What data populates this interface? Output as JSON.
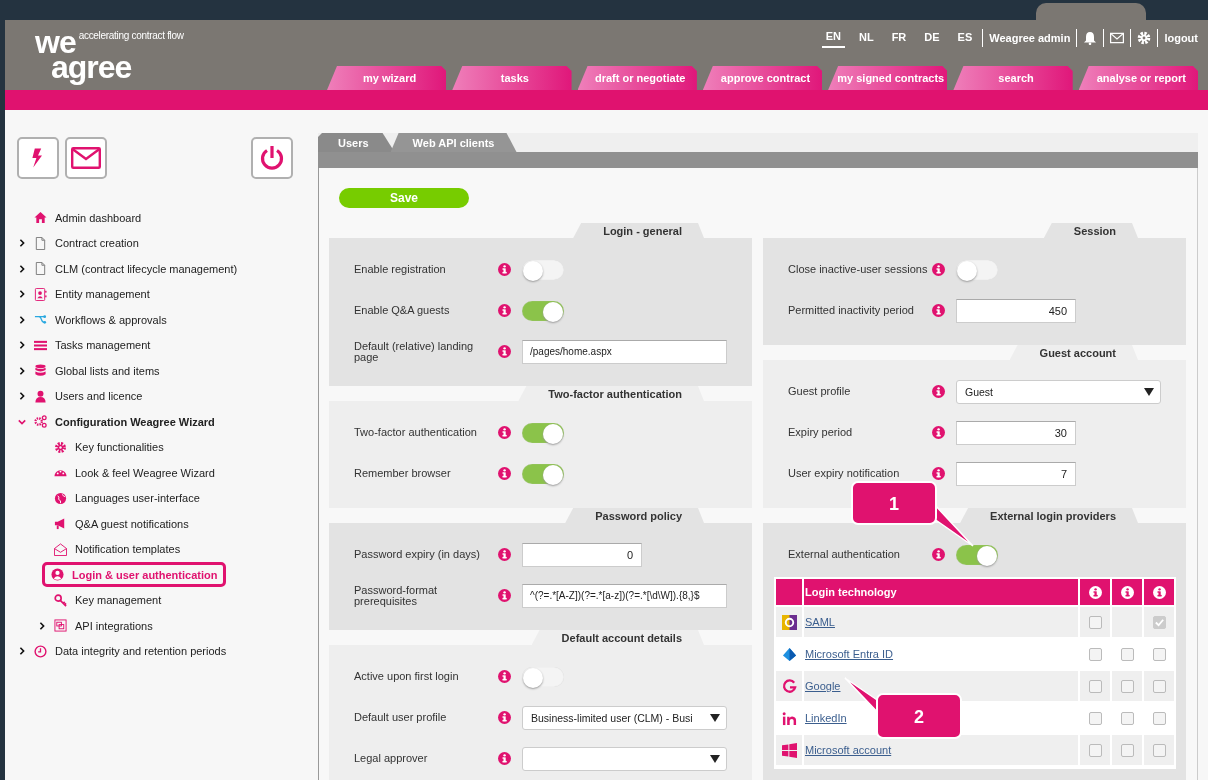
{
  "header": {
    "logo_top": "we",
    "logo_bottom": "agree",
    "tagline": "accelerating contract flow",
    "languages": [
      {
        "label": "EN",
        "selected": true
      },
      {
        "label": "NL",
        "selected": false
      },
      {
        "label": "FR",
        "selected": false
      },
      {
        "label": "DE",
        "selected": false
      },
      {
        "label": "ES",
        "selected": false
      }
    ],
    "user": "Weagree admin",
    "logout": "logout"
  },
  "nav_tabs": [
    "my wizard",
    "tasks",
    "draft or negotiate",
    "approve contract",
    "my signed contracts",
    "search",
    "analyse or report"
  ],
  "sidebar": {
    "items": [
      {
        "label": "Admin dashboard",
        "selected": false
      },
      {
        "label": "Contract creation",
        "expanded": false,
        "selected": false
      },
      {
        "label": "CLM (contract lifecycle management)",
        "expanded": false,
        "selected": false
      },
      {
        "label": "Entity management",
        "expanded": false,
        "selected": false
      },
      {
        "label": "Workflows & approvals",
        "expanded": false,
        "selected": false
      },
      {
        "label": "Tasks management",
        "expanded": false,
        "selected": false
      },
      {
        "label": "Global lists and items",
        "expanded": false,
        "selected": false
      },
      {
        "label": "Users and licence",
        "expanded": false,
        "selected": false
      },
      {
        "label": "Configuration Weagree Wizard",
        "expanded": true,
        "selected": false,
        "children": [
          {
            "label": "Key functionalities",
            "selected": false
          },
          {
            "label": "Look & feel Weagree Wizard",
            "selected": false
          },
          {
            "label": "Languages user-interface",
            "selected": false
          },
          {
            "label": "Q&A guest notifications",
            "selected": false
          },
          {
            "label": "Notification templates",
            "selected": false
          },
          {
            "label": "Login & user authentication",
            "selected": true
          },
          {
            "label": "Key management",
            "selected": false
          },
          {
            "label": "API integrations",
            "expanded": false,
            "selected": false
          }
        ]
      },
      {
        "label": "Data integrity and retention periods",
        "expanded": false,
        "selected": false
      }
    ]
  },
  "tabs": [
    {
      "label": "Users",
      "selected": true
    },
    {
      "label": "Web API clients",
      "selected": false
    }
  ],
  "save_button": "Save",
  "columns": [
    [
      {
        "title": "Login - general",
        "rows": [
          {
            "kind": "toggle",
            "label": "Enable registration",
            "on": false
          },
          {
            "kind": "toggle",
            "label": "Enable Q&A guests",
            "on": true
          },
          {
            "kind": "text",
            "label": "Default (relative) landing page",
            "value": "/pages/home.aspx"
          }
        ]
      },
      {
        "title": "Two-factor authentication",
        "rows": [
          {
            "kind": "toggle",
            "label": "Two-factor authentication",
            "on": true
          },
          {
            "kind": "toggle",
            "label": "Remember browser",
            "on": true
          }
        ]
      },
      {
        "title": "Password policy",
        "rows": [
          {
            "kind": "number",
            "label": "Password expiry (in days)",
            "value": "0"
          },
          {
            "kind": "text",
            "label": "Password-format prerequisites",
            "value": "^(?=.*[A-Z])(?=.*[a-z])(?=.*[\\d\\W]).{8,}$"
          }
        ]
      },
      {
        "title": "Default account details",
        "rows": [
          {
            "kind": "toggle",
            "label": "Active upon first login",
            "on": false
          },
          {
            "kind": "select",
            "label": "Default user profile",
            "value": "Business-limited user (CLM) - Busi"
          },
          {
            "kind": "select",
            "label": "Legal approver"
          }
        ]
      }
    ],
    [
      {
        "title": "Session",
        "rows": [
          {
            "kind": "toggle",
            "label": "Close inactive-user sessions",
            "on": false
          },
          {
            "kind": "number",
            "label": "Permitted inactivity period",
            "value": "450"
          }
        ]
      },
      {
        "title": "Guest account",
        "rows": [
          {
            "kind": "select",
            "label": "Guest profile",
            "value": "Guest"
          },
          {
            "kind": "number",
            "label": "Expiry period",
            "value": "30"
          },
          {
            "kind": "number",
            "label": "User expiry notification",
            "value": "7"
          }
        ]
      },
      {
        "title": "External login providers",
        "rows": [
          {
            "kind": "toggle",
            "label": "External authentication",
            "on": true
          }
        ],
        "table": {
          "heading": "Login technology",
          "rows": [
            {
              "name": "SAML",
              "cells": [
                {
                  "kind": "checkbox",
                  "checked": false,
                  "disabled": false
                },
                {
                  "kind": "empty"
                },
                {
                  "kind": "checkbox",
                  "checked": true,
                  "disabled": true
                }
              ]
            },
            {
              "name": "Microsoft Entra ID",
              "cells": [
                {
                  "kind": "checkbox",
                  "checked": false,
                  "disabled": false
                },
                {
                  "kind": "checkbox",
                  "checked": false,
                  "disabled": false
                },
                {
                  "kind": "checkbox",
                  "checked": false,
                  "disabled": false
                }
              ]
            },
            {
              "name": "Google",
              "cells": [
                {
                  "kind": "checkbox",
                  "checked": false,
                  "disabled": false
                },
                {
                  "kind": "checkbox",
                  "checked": false,
                  "disabled": false
                },
                {
                  "kind": "checkbox",
                  "checked": false,
                  "disabled": false
                }
              ]
            },
            {
              "name": "LinkedIn",
              "cells": [
                {
                  "kind": "checkbox",
                  "checked": false,
                  "disabled": false
                },
                {
                  "kind": "checkbox",
                  "checked": false,
                  "disabled": false
                },
                {
                  "kind": "checkbox",
                  "checked": false,
                  "disabled": false
                }
              ]
            },
            {
              "name": "Microsoft account",
              "cells": [
                {
                  "kind": "checkbox",
                  "checked": false,
                  "disabled": false
                },
                {
                  "kind": "checkbox",
                  "checked": false,
                  "disabled": false
                },
                {
                  "kind": "checkbox",
                  "checked": false,
                  "disabled": false
                }
              ]
            }
          ]
        }
      }
    ]
  ],
  "callouts": [
    {
      "label": "1"
    },
    {
      "label": "2"
    }
  ]
}
